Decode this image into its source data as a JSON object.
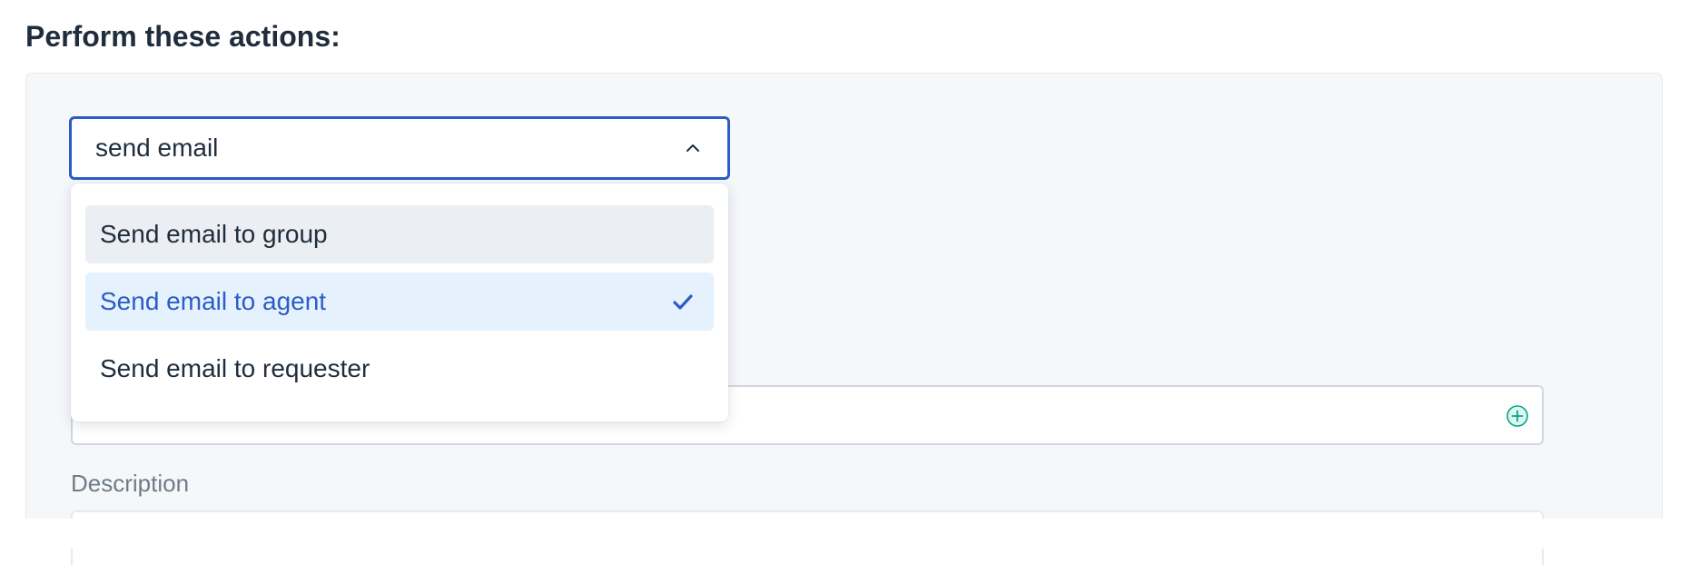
{
  "page": {
    "title": "Perform these actions:"
  },
  "action_select": {
    "value": "send email",
    "icon": "chevron-up-icon",
    "expanded": true
  },
  "dropdown": {
    "options": [
      {
        "label": "Send email to group",
        "state": "hovered"
      },
      {
        "label": "Send email to agent",
        "state": "selected",
        "icon": "checkmark-icon"
      },
      {
        "label": "Send email to requester",
        "state": "default"
      }
    ]
  },
  "recipient_field": {
    "value": "",
    "icon": "add-circle-icon"
  },
  "description": {
    "label": "Description",
    "value": ""
  },
  "colors": {
    "accent": "#2c5cc5",
    "panel_bg": "#f5f7f9",
    "hover_bg": "#ebeff3",
    "selected_bg": "#e5f2fd",
    "add_icon": "#00a886"
  }
}
